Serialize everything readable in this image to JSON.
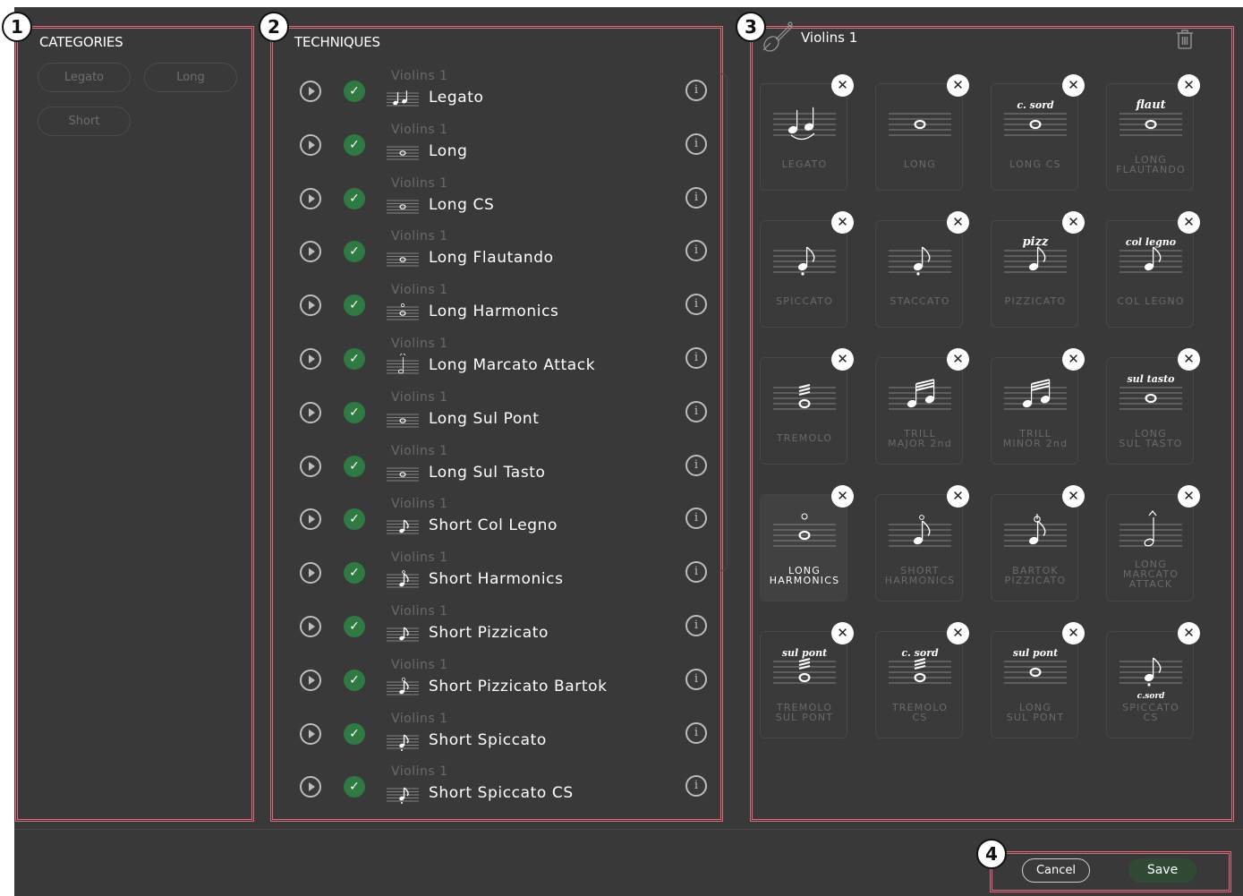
{
  "markers": [
    "1",
    "2",
    "3",
    "4"
  ],
  "categories": {
    "title": "CATEGORIES",
    "items": [
      "Legato",
      "Long",
      "Short"
    ]
  },
  "techniques": {
    "title": "TECHNIQUES",
    "rows": [
      {
        "instrument": "Violins 1",
        "name": "Legato",
        "icon": "legato-notes-icon"
      },
      {
        "instrument": "Violins 1",
        "name": "Long",
        "icon": "whole-note-icon"
      },
      {
        "instrument": "Violins 1",
        "name": "Long CS",
        "icon": "whole-note-csord-icon"
      },
      {
        "instrument": "Violins 1",
        "name": "Long Flautando",
        "icon": "whole-note-flaut-icon"
      },
      {
        "instrument": "Violins 1",
        "name": "Long Harmonics",
        "icon": "whole-note-harmonic-icon"
      },
      {
        "instrument": "Violins 1",
        "name": "Long Marcato Attack",
        "icon": "marcato-note-icon"
      },
      {
        "instrument": "Violins 1",
        "name": "Long Sul Pont",
        "icon": "whole-note-sulpont-icon"
      },
      {
        "instrument": "Violins 1",
        "name": "Long Sul Tasto",
        "icon": "whole-note-sultasto-icon"
      },
      {
        "instrument": "Violins 1",
        "name": "Short Col Legno",
        "icon": "eighth-note-collegno-icon"
      },
      {
        "instrument": "Violins 1",
        "name": "Short Harmonics",
        "icon": "eighth-note-harmonic-icon"
      },
      {
        "instrument": "Violins 1",
        "name": "Short Pizzicato",
        "icon": "eighth-note-pizz-icon"
      },
      {
        "instrument": "Violins 1",
        "name": "Short Pizzicato Bartok",
        "icon": "eighth-note-bartok-icon"
      },
      {
        "instrument": "Violins 1",
        "name": "Short Spiccato",
        "icon": "eighth-note-spiccato-icon"
      },
      {
        "instrument": "Violins 1",
        "name": "Short Spiccato CS",
        "icon": "eighth-note-spiccato-cs-icon"
      }
    ]
  },
  "instrument_panel": {
    "title": "Violins 1",
    "icon": "violin-icon",
    "delete_icon": "trash-icon",
    "cards": [
      {
        "line1": "LEGATO",
        "line2": "",
        "art": "legato",
        "top_text": "",
        "bottom_text": "",
        "selected": false
      },
      {
        "line1": "LONG",
        "line2": "",
        "art": "whole",
        "top_text": "",
        "bottom_text": "",
        "selected": false
      },
      {
        "line1": "LONG CS",
        "line2": "",
        "art": "whole",
        "top_text": "c. sord",
        "bottom_text": "",
        "selected": false
      },
      {
        "line1": "LONG",
        "line2": "FLAUTANDO",
        "art": "whole",
        "top_text": "flaut",
        "bottom_text": "",
        "selected": false
      },
      {
        "line1": "SPICCATO",
        "line2": "",
        "art": "eighth-dot",
        "top_text": "",
        "bottom_text": "",
        "selected": false
      },
      {
        "line1": "STACCATO",
        "line2": "",
        "art": "eighth-dot",
        "top_text": "",
        "bottom_text": "",
        "selected": false
      },
      {
        "line1": "PIZZICATO",
        "line2": "",
        "art": "eighth",
        "top_text": "pizz",
        "bottom_text": "",
        "selected": false
      },
      {
        "line1": "COL LEGNO",
        "line2": "",
        "art": "eighth",
        "top_text": "col legno",
        "bottom_text": "",
        "selected": false
      },
      {
        "line1": "TREMOLO",
        "line2": "",
        "art": "tremolo",
        "top_text": "",
        "bottom_text": "",
        "selected": false
      },
      {
        "line1": "TRILL",
        "line2": "MAJOR 2nd",
        "art": "sixteenths",
        "top_text": "",
        "bottom_text": "",
        "selected": false
      },
      {
        "line1": "TRILL",
        "line2": "MINOR 2nd",
        "art": "sixteenths",
        "top_text": "",
        "bottom_text": "",
        "selected": false
      },
      {
        "line1": "LONG",
        "line2": "SUL TASTO",
        "art": "whole",
        "top_text": "sul tasto",
        "bottom_text": "",
        "selected": false
      },
      {
        "line1": "LONG",
        "line2": "HARMONICS",
        "art": "whole-harmonic",
        "top_text": "",
        "bottom_text": "",
        "selected": true
      },
      {
        "line1": "SHORT",
        "line2": "HARMONICS",
        "art": "eighth-harmonic",
        "top_text": "",
        "bottom_text": "",
        "selected": false
      },
      {
        "line1": "BARTOK",
        "line2": "PIZZICATO",
        "art": "eighth-bartok",
        "top_text": "",
        "bottom_text": "",
        "selected": false
      },
      {
        "line1": "LONG",
        "line2": "MARCATO",
        "line3": "ATTACK",
        "art": "half-marcato",
        "top_text": "",
        "bottom_text": "",
        "selected": false
      },
      {
        "line1": "TREMOLO",
        "line2": "SUL PONT",
        "art": "tremolo",
        "top_text": "sul pont",
        "bottom_text": "",
        "selected": false
      },
      {
        "line1": "TREMOLO",
        "line2": "CS",
        "art": "tremolo",
        "top_text": "c. sord",
        "bottom_text": "",
        "selected": false
      },
      {
        "line1": "LONG",
        "line2": "SUL PONT",
        "art": "whole",
        "top_text": "sul pont",
        "bottom_text": "",
        "selected": false
      },
      {
        "line1": "SPICCATO",
        "line2": "CS",
        "art": "eighth-dot",
        "top_text": "",
        "bottom_text": "c.sord",
        "selected": false
      }
    ]
  },
  "footer": {
    "cancel_label": "Cancel",
    "save_label": "Save"
  },
  "colors": {
    "background": "#393939",
    "panel_outline": "#e06a78",
    "check_green": "#2f7a43",
    "save_green": "#304a36"
  }
}
